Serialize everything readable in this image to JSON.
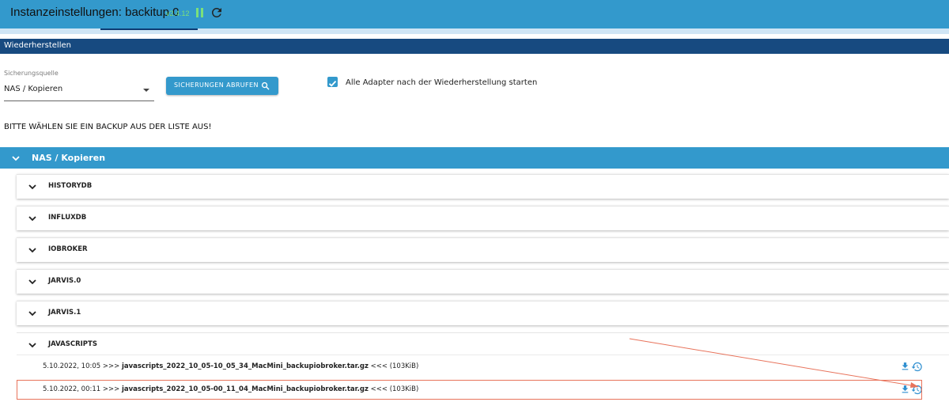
{
  "header": {
    "title": "Instanzeinstellungen: backitup.0",
    "version": "v2.4.12"
  },
  "section": {
    "title": "Wiederherstellen"
  },
  "source": {
    "label": "Sicherungsquelle",
    "value": "NAS / Kopieren"
  },
  "fetch_button": {
    "label": "SICHERUNGEN ABRUFEN"
  },
  "autostart": {
    "checked": true,
    "label": "Alle Adapter nach der Wiederherstellung starten"
  },
  "instruction": "BITTE WÄHLEN SIE EIN BACKUP AUS DER LISTE AUS!",
  "main_accordion": {
    "label": "NAS / Kopieren"
  },
  "groups": [
    {
      "label": "HISTORYDB"
    },
    {
      "label": "INFLUXDB"
    },
    {
      "label": "IOBROKER"
    },
    {
      "label": "JARVIS.0"
    },
    {
      "label": "JARVIS.1"
    },
    {
      "label": "JAVASCRIPTS"
    }
  ],
  "backups": [
    {
      "date": "5.10.2022, 10:05",
      "prefix": ">>>",
      "file": "javascripts_2022_10_05-10_05_34_MacMini_backupiobroker.tar.gz",
      "suffix": "<<<",
      "size": "(103KiB)"
    },
    {
      "date": "5.10.2022, 00:11",
      "prefix": ">>>",
      "file": "javascripts_2022_10_05-00_11_04_MacMini_backupiobroker.tar.gz",
      "suffix": "<<<",
      "size": "(103KiB)"
    }
  ],
  "colors": {
    "primary": "#3399cc",
    "section": "#174a80",
    "annotation": "#e8735b"
  }
}
